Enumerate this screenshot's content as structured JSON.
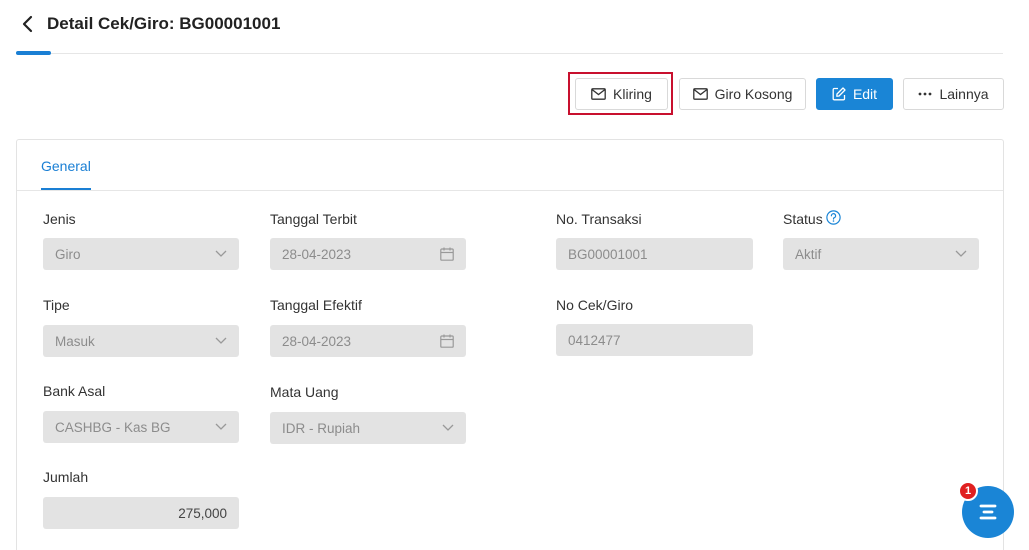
{
  "header": {
    "title": "Detail Cek/Giro: BG00001001"
  },
  "toolbar": {
    "kliring_label": "Kliring",
    "giro_kosong_label": "Giro Kosong",
    "edit_label": "Edit",
    "lainnya_label": "Lainnya"
  },
  "tabs": {
    "general": "General"
  },
  "form": {
    "jenis": {
      "label": "Jenis",
      "value": "Giro"
    },
    "tipe": {
      "label": "Tipe",
      "value": "Masuk"
    },
    "bank_asal": {
      "label": "Bank Asal",
      "value": "CASHBG - Kas BG"
    },
    "jumlah": {
      "label": "Jumlah",
      "value": "275,000"
    },
    "tanggal_terbit": {
      "label": "Tanggal Terbit",
      "value": "28-04-2023"
    },
    "tanggal_efektif": {
      "label": "Tanggal Efektif",
      "value": "28-04-2023"
    },
    "mata_uang": {
      "label": "Mata Uang",
      "value": "IDR - Rupiah"
    },
    "no_transaksi": {
      "label": "No. Transaksi",
      "value": "BG00001001"
    },
    "no_cek_giro": {
      "label": "No Cek/Giro",
      "value": "0412477"
    },
    "status": {
      "label": "Status",
      "value": "Aktif"
    }
  },
  "chat": {
    "badge_count": "1"
  },
  "colors": {
    "accent": "#1a85d6",
    "highlight": "#c8102e",
    "badge": "#e02020"
  }
}
